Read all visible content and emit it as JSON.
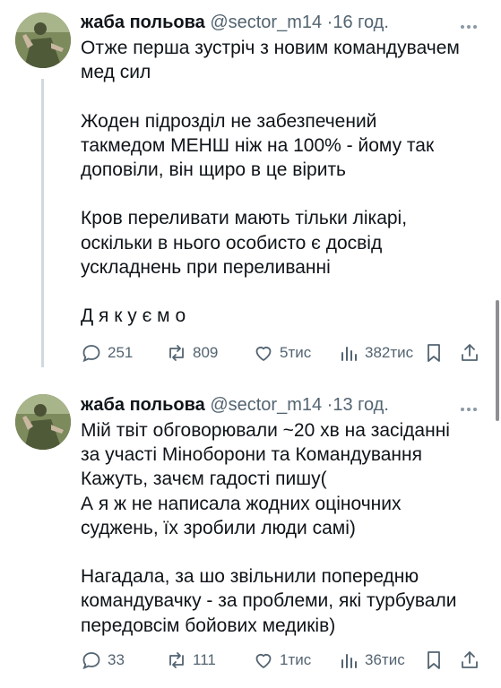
{
  "tweets": [
    {
      "author_name": "жаба польова",
      "handle": "@sector_m14",
      "separator": "·",
      "time": "16 год.",
      "text": "Отже перша зустріч з новим командувачем\nмед сил\n\nЖоден підрозділ не забезпечений\nтакмедом МЕНШ ніж на 100% - йому так\nдоповіли, він щиро в це вірить\n\nКров переливати мають тільки лікарі,\nоскільки в нього особисто є досвід\nускладнень при переливанні\n\nД я к у є м о",
      "replies": "251",
      "reposts": "809",
      "likes": "5тис",
      "views": "382тис"
    },
    {
      "author_name": "жаба польова",
      "handle": "@sector_m14",
      "separator": "·",
      "time": "13 год.",
      "text": "Мій твіт обговорювали ~20 хв на засіданні\nза участі Міноборони та Командування\nКажуть, зачєм гадості пишу(\nА я ж не написала жодних оціночних\nсуджень, їх зробили люди самі)\n\nНагадала, за шо звільнили попередню\nкомандувачку - за проблеми, які турбували\nпередовсім бойових медиків)",
      "replies": "33",
      "reposts": "111",
      "likes": "1тис",
      "views": "36тис"
    }
  ],
  "icons": [
    "more-icon",
    "reply-icon",
    "repost-icon",
    "like-icon",
    "views-icon",
    "bookmark-icon",
    "share-icon"
  ],
  "colors": {
    "text": "#0f1419",
    "secondary": "#536471",
    "thread_line": "#cfd9de"
  }
}
